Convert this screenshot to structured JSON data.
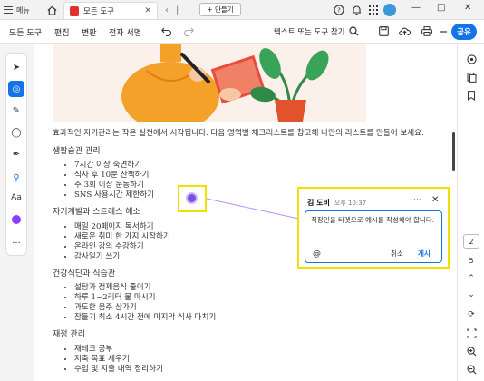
{
  "topbar": {
    "menu_label": "메뉴",
    "tab_title": "모든 도구",
    "new_tab_label": "+ 만들기",
    "window_minimize": "—",
    "window_maximize": "□",
    "window_close": "✕"
  },
  "toolbar": {
    "items": [
      "모든 도구",
      "편집",
      "변환",
      "전자 서명"
    ],
    "search_text": "텍스트 또는 도구 찾기",
    "share_label": "공유"
  },
  "left_tools": [
    {
      "icon": "arrow-select-icon",
      "glyph": "➤"
    },
    {
      "icon": "add-comment-icon",
      "glyph": "💬",
      "active": true
    },
    {
      "icon": "pen-icon",
      "glyph": "✎"
    },
    {
      "icon": "lasso-icon",
      "glyph": "◯"
    },
    {
      "icon": "fill-sign-icon",
      "glyph": "✒"
    },
    {
      "icon": "pin-icon",
      "glyph": "📍"
    },
    {
      "icon": "text-icon",
      "glyph": "Aa"
    },
    {
      "icon": "color-icon",
      "glyph": ""
    },
    {
      "icon": "more-icon",
      "glyph": "···"
    }
  ],
  "document": {
    "intro": "효과적인 자기관리는 작은 실천에서 시작됩니다. 다음 영역별 체크리스트를 참고해 나만의 리스트를 만들어 보세요.",
    "sections": [
      {
        "title": "생활습관 관리",
        "items": [
          "7시간 이상 숙면하기",
          "식사 후 10분 산책하기",
          "주 3회 이상 운동하기",
          "SNS 사용시간 제한하기"
        ]
      },
      {
        "title": "자기계발과 스트레스 해소",
        "items": [
          "매일 20페이지 독서하기",
          "새로운 취미 한 가지 시작하기",
          "온라인 강의 수강하기",
          "감사일기 쓰기"
        ]
      },
      {
        "title": "건강식단과 식습관",
        "items": [
          "설탕과 정제음식 줄이기",
          "하루 1~2리터 물 마시기",
          "과도한 음주 삼가기",
          "잠들기 최소 4시간 전에 마지막 식사 마치기"
        ]
      },
      {
        "title": "재정 관리",
        "items": [
          "재테크 공부",
          "저축 목표 세우기",
          "수입 및 지출 내역 정리하기"
        ]
      }
    ]
  },
  "comment": {
    "author": "김 도비",
    "time": "오후 10:37",
    "more": "···",
    "close": "✕",
    "body": "직장인을 타겟으로 예시를 작성해야 합니다.",
    "mention": "@",
    "cancel": "취소",
    "post": "게시"
  },
  "right_rail": {
    "page_current": "2",
    "page_total": "5"
  },
  "colors": {
    "accent": "#1473e6",
    "highlight": "#f0e000",
    "pin": "#7b4fe0"
  }
}
